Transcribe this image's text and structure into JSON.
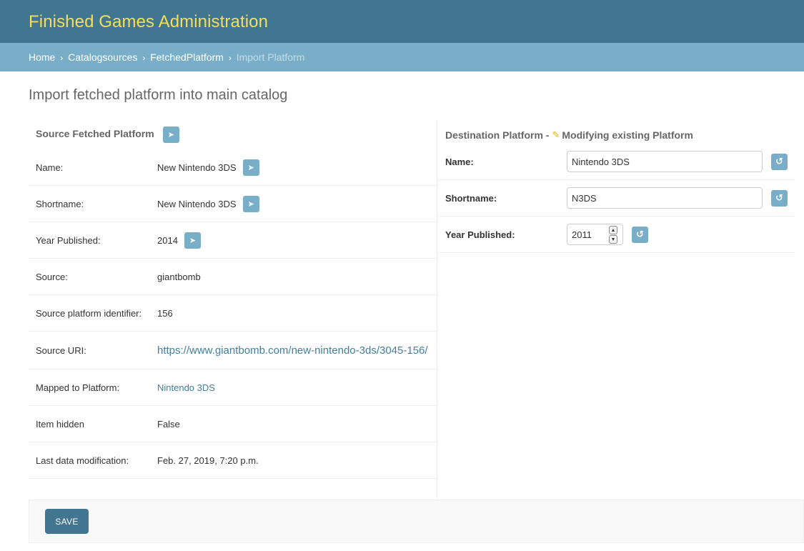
{
  "header": {
    "site_title": "Finished Games Administration"
  },
  "breadcrumbs": {
    "home": "Home",
    "catalogsources": "Catalogsources",
    "fetched_platform": "FetchedPlatform",
    "current": "Import Platform",
    "separator": "›"
  },
  "page_title": "Import fetched platform into main catalog",
  "source": {
    "title": "Source Fetched Platform",
    "rows": [
      {
        "label": "Name:",
        "value": "New Nintendo 3DS"
      },
      {
        "label": "Shortname:",
        "value": "New Nintendo 3DS"
      },
      {
        "label": "Year Published:",
        "value": "2014"
      },
      {
        "label": "Source:",
        "value": "giantbomb"
      },
      {
        "label": "Source platform identifier:",
        "value": "156"
      },
      {
        "label": "Source URI:",
        "value": "https://www.giantbomb.com/new-nintendo-3ds/3045-156/"
      },
      {
        "label": "Mapped to Platform:",
        "value": "Nintendo 3DS"
      },
      {
        "label": "Item hidden",
        "value": "False"
      },
      {
        "label": "Last data modification:",
        "value": "Feb. 27, 2019, 7:20 p.m."
      }
    ]
  },
  "destination": {
    "title_prefix": "Destination Platform - ",
    "title_suffix": "Modifying existing Platform",
    "name_label": "Name:",
    "name_value": "Nintendo 3DS",
    "shortname_label": "Shortname:",
    "shortname_value": "N3DS",
    "year_label": "Year Published:",
    "year_value": "2011"
  },
  "actions": {
    "save_label": "SAVE"
  },
  "icons": {
    "arrow": "➤",
    "undo": "↺",
    "pencil": "✎",
    "spin_up": "▲",
    "spin_down": "▼"
  },
  "colors": {
    "header_bg": "#417690",
    "title_yellow": "#f5dd5d",
    "breadcrumb_bg": "#79aec8",
    "link": "#447e9b",
    "button": "#79aec8",
    "save_button": "#417690"
  }
}
